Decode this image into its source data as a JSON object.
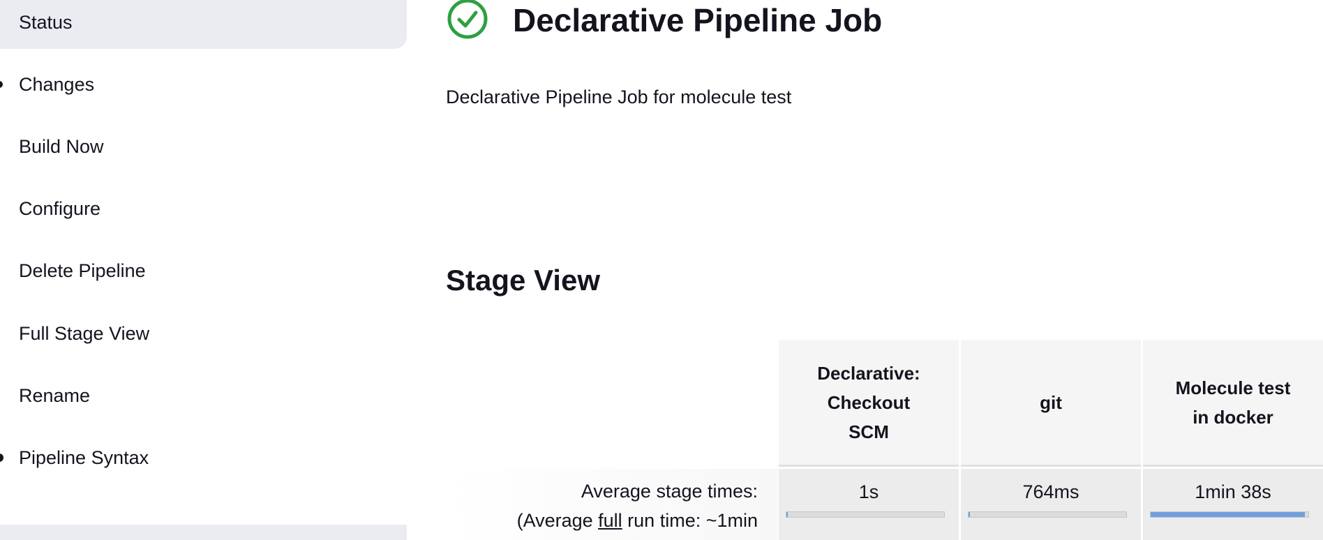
{
  "sidebar": {
    "items": [
      {
        "label": "Status"
      },
      {
        "label": "Changes"
      },
      {
        "label": "Build Now"
      },
      {
        "label": "Configure"
      },
      {
        "label": "Delete Pipeline"
      },
      {
        "label": "Full Stage View"
      },
      {
        "label": "Rename"
      },
      {
        "label": "Pipeline Syntax"
      }
    ]
  },
  "job": {
    "title": "Declarative Pipeline Job",
    "description": "Declarative Pipeline Job for molecule test",
    "status_icon": "success-check-circle-icon",
    "status_color": "#2ea043"
  },
  "stage_view": {
    "heading": "Stage View",
    "average_label": "Average stage times:",
    "full_run_prefix": "(Average ",
    "full_run_link": "full",
    "full_run_suffix": " run time: ~1min",
    "stages": [
      {
        "name_lines": [
          "Declarative:",
          "Checkout",
          "SCM"
        ],
        "avg_time": "1s",
        "bar_fraction": 0.01
      },
      {
        "name_lines": [
          "git"
        ],
        "avg_time": "764ms",
        "bar_fraction": 0.01
      },
      {
        "name_lines": [
          "Molecule test",
          "in docker"
        ],
        "avg_time": "1min 38s",
        "bar_fraction": 0.98
      }
    ],
    "bar_color": "#6f9fe0"
  }
}
